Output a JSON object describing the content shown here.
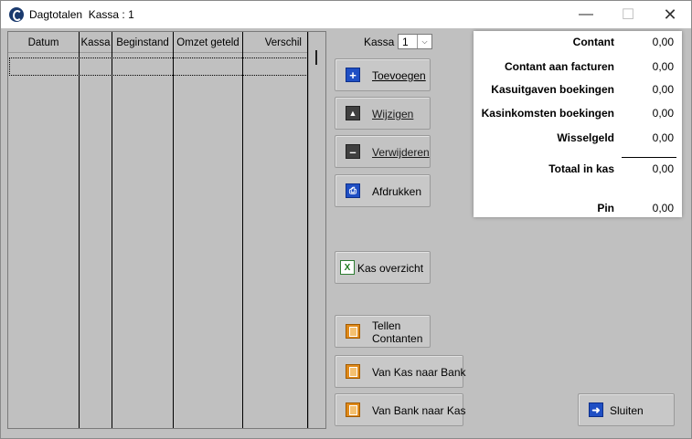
{
  "window": {
    "title": "Dagtotalen  Kassa : 1"
  },
  "grid": {
    "columns": [
      "Datum",
      "Kassa",
      "Beginstand",
      "Omzet geteld",
      "Verschil"
    ]
  },
  "kassa": {
    "label": "Kassa",
    "value": "1"
  },
  "buttons": {
    "toevoegen": "Toevoegen",
    "wijzigen": "Wijzigen",
    "verwijderen": "Verwijderen",
    "afdrukken": "Afdrukken",
    "kas_overzicht": "Kas overzicht",
    "tellen_line1": "Tellen",
    "tellen_line2": "Contanten",
    "kas_naar_bank": "Van Kas naar Bank",
    "bank_naar_kas": "Van Bank naar Kas",
    "sluiten": "Sluiten"
  },
  "summary": {
    "contant": {
      "label": "Contant",
      "value": "0,00"
    },
    "contant_facturen": {
      "label": "Contant aan facturen",
      "value": "0,00"
    },
    "kasuitgaven": {
      "label": "Kasuitgaven boekingen",
      "value": "0,00"
    },
    "kasinkomsten": {
      "label": "Kasinkomsten boekingen",
      "value": "0,00"
    },
    "wisselgeld": {
      "label": "Wisselgeld",
      "value": "0,00"
    },
    "totaal": {
      "label": "Totaal in kas",
      "value": "0,00"
    },
    "pin": {
      "label": "Pin",
      "value": "0,00"
    }
  },
  "colors": {
    "accent_blue": "#1f4fc4",
    "window_bg": "#c0c0c0"
  },
  "icons": [
    "app-icon",
    "minimize-icon",
    "maximize-icon",
    "close-icon",
    "plus-icon",
    "eject-icon",
    "minus-icon",
    "print-icon",
    "excel-icon",
    "calculator-icon",
    "exit-icon"
  ]
}
